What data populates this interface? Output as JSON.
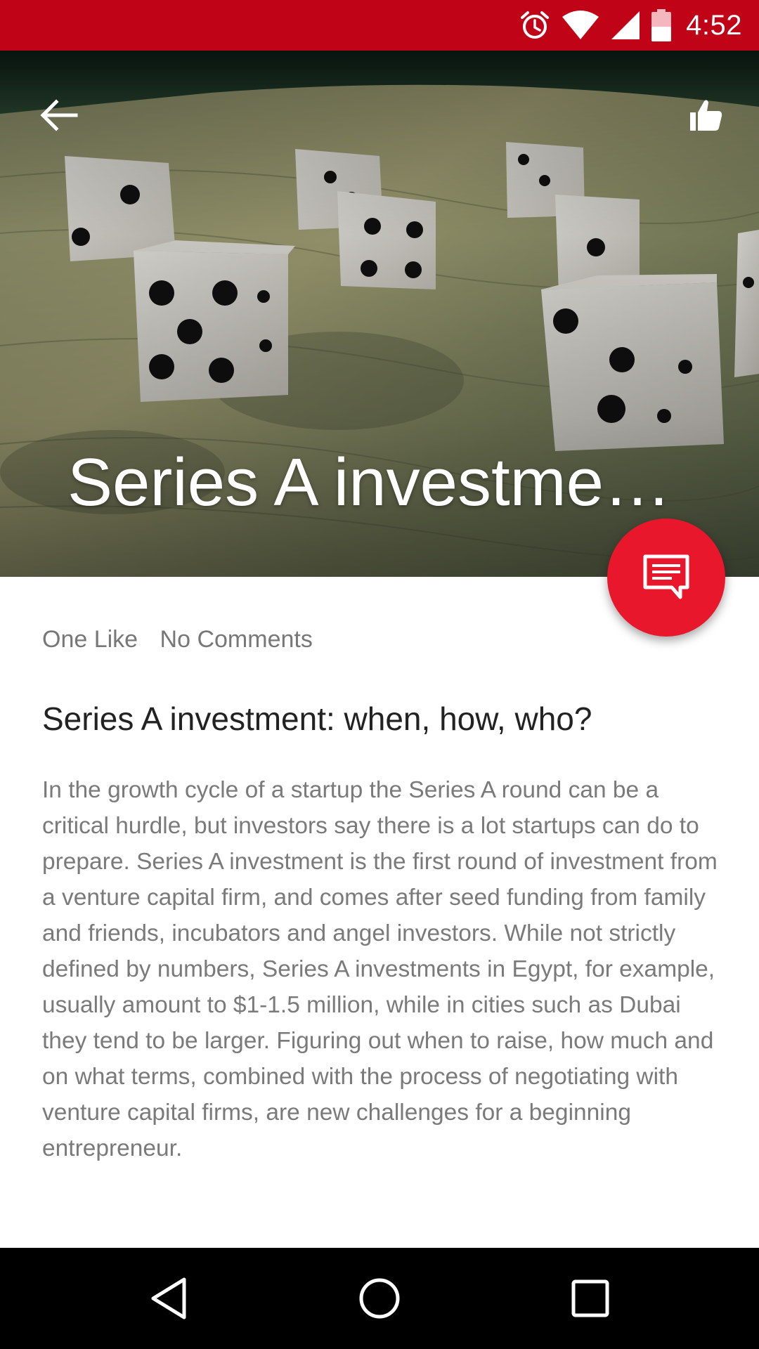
{
  "status_bar": {
    "time": "4:52",
    "icons": [
      "alarm-icon",
      "wifi-icon",
      "cell-signal-icon",
      "battery-low-icon"
    ],
    "background": "#c00316"
  },
  "hero": {
    "title": "Series A investment: when, how, who?",
    "image": "dice-on-money-photo"
  },
  "toolbar": {
    "back_icon": "arrow-left-icon",
    "like_icon": "thumbs-up-icon"
  },
  "fab": {
    "icon": "comment-icon",
    "color": "#e8172c"
  },
  "article": {
    "likes": "One Like",
    "comments": "No Comments",
    "title": "Series A investment: when, how, who?",
    "body": "In the growth cycle of a startup the Series A round can be a critical hurdle, but investors say there is a lot startups can do to prepare. Series A investment is the first round of investment from a venture capital firm, and comes after seed funding from family and friends, incubators and angel investors. While not strictly defined by numbers, Series A investments in Egypt, for example, usually amount to $1-1.5 million, while in cities such as Dubai they tend to be larger. Figuring out when to raise, how much and on what terms, combined with the process of negotiating with venture capital firms, are new challenges for a beginning entrepreneur."
  },
  "nav_bar": {
    "buttons": [
      "back-triangle-icon",
      "home-circle-icon",
      "recents-square-icon"
    ]
  }
}
